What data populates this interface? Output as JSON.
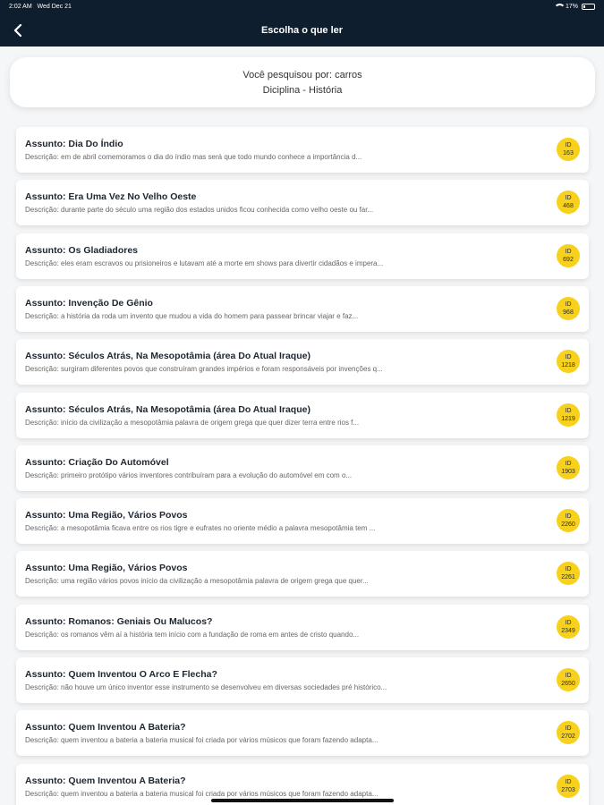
{
  "status": {
    "time": "2:02 AM",
    "date": "Wed Dec 21",
    "battery": "17%"
  },
  "header": {
    "title": "Escolha o que ler",
    "back_icon": "chevron-left-icon"
  },
  "summary": {
    "line1": "Você pesquisou por: carros",
    "line2": "Diciplina - História"
  },
  "items": [
    {
      "subject": "Assunto: Dia Do Índio",
      "desc": "Descrição: em de abril comemoramos o dia do índio mas será que todo mundo conhece a importância d...",
      "id_label": "ID",
      "id": "163"
    },
    {
      "subject": "Assunto: Era Uma Vez No Velho Oeste",
      "desc": "Descrição: durante parte do século uma região dos estados unidos ficou conhecida como velho oeste ou far...",
      "id_label": "ID",
      "id": "468"
    },
    {
      "subject": "Assunto: Os Gladiadores",
      "desc": "Descrição: eles eram escravos ou prisioneiros e lutavam até a morte em shows para divertir cidadãos e impera...",
      "id_label": "ID",
      "id": "692"
    },
    {
      "subject": "Assunto: Invenção De Gênio",
      "desc": "Descrição: a história da roda um invento que mudou a vida do homem para passear brincar viajar e faz...",
      "id_label": "ID",
      "id": "968"
    },
    {
      "subject": "Assunto: Séculos Atrás, Na Mesopotâmia (área Do Atual Iraque)",
      "desc": "Descrição: surgiram diferentes povos que construíram grandes impérios e foram responsáveis por invenções q...",
      "id_label": "ID",
      "id": "1218"
    },
    {
      "subject": "Assunto: Séculos Atrás, Na Mesopotâmia (área Do Atual Iraque)",
      "desc": "Descrição: início da civilização a mesopotâmia palavra de origem grega que quer dizer terra entre rios f...",
      "id_label": "ID",
      "id": "1219"
    },
    {
      "subject": "Assunto: Criação Do Automóvel",
      "desc": "Descrição: primeiro protótipo vários inventores contribuíram para a evolução do automóvel em com o...",
      "id_label": "ID",
      "id": "1903"
    },
    {
      "subject": "Assunto: Uma Região, Vários Povos",
      "desc": "Descrição: a mesopotâmia ficava entre os rios tigre e eufrates no oriente médio a palavra mesopotâmia tem ...",
      "id_label": "ID",
      "id": "2260"
    },
    {
      "subject": "Assunto: Uma Região, Vários Povos",
      "desc": "Descrição: uma região vários povos início da civilização a mesopotâmia palavra de origem grega que quer...",
      "id_label": "ID",
      "id": "2261"
    },
    {
      "subject": "Assunto: Romanos: Geniais Ou Malucos?",
      "desc": "Descrição: os romanos vêm aí a história tem início com a fundação de roma em antes de cristo quando...",
      "id_label": "ID",
      "id": "2349"
    },
    {
      "subject": "Assunto: Quem Inventou O Arco E Flecha?",
      "desc": "Descrição: não houve um único inventor esse instrumento se desenvolveu em diversas sociedades pré histórico...",
      "id_label": "ID",
      "id": "2650"
    },
    {
      "subject": "Assunto: Quem Inventou A Bateria?",
      "desc": "Descrição: quem inventou a bateria a bateria musical foi criada por vários músicos que foram fazendo adapta...",
      "id_label": "ID",
      "id": "2702"
    },
    {
      "subject": "Assunto: Quem Inventou A Bateria?",
      "desc": "Descrição: quem inventou a bateria a bateria musical foi criada por vários músicos que foram fazendo adapta...",
      "id_label": "ID",
      "id": "2703"
    }
  ],
  "colors": {
    "header_bg": "#0f1e2e",
    "badge": "#f7d11c",
    "page_bg": "#f4f6f8"
  }
}
